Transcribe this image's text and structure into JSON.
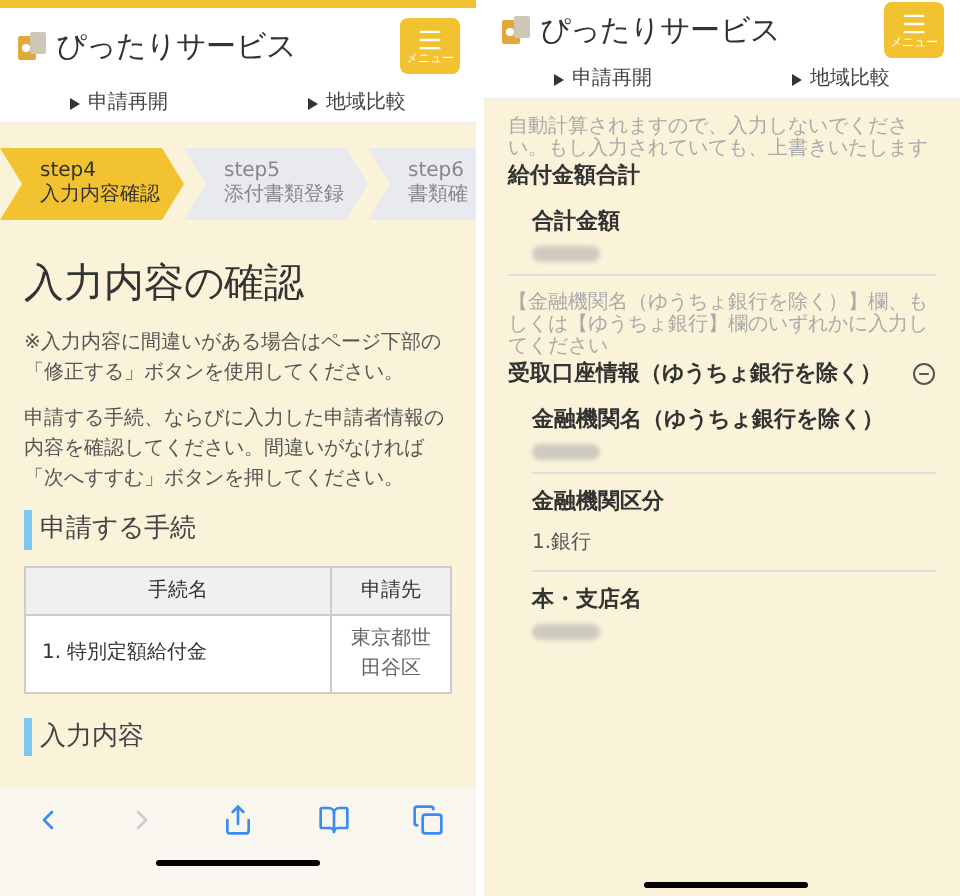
{
  "left": {
    "header": {
      "title": "ぴったりサービス",
      "menu_label": "メニュー"
    },
    "nav": [
      "申請再開",
      "地域比較"
    ],
    "steps": [
      {
        "step": "step4",
        "label": "入力内容確認",
        "selected": true
      },
      {
        "step": "step5",
        "label": "添付書類登録",
        "selected": false
      },
      {
        "step": "step6",
        "label": "書類確",
        "selected": false
      }
    ],
    "page_title": "入力内容の確認",
    "notes": [
      "※入力内容に間違いがある場合はページ下部の「修正する」ボタンを使用してください。",
      "申請する手続、ならびに入力した申請者情報の内容を確認してください。間違いがなければ「次へすすむ」ボタンを押してください。"
    ],
    "section_title": "申請する手続",
    "table": {
      "columns": [
        "手続名",
        "申請先"
      ],
      "rows": [
        [
          "1. 特別定額給付金",
          "東京都世田谷区"
        ]
      ]
    },
    "section_title_2": "入力内容",
    "toolbar": [
      {
        "disabled": false
      },
      {
        "disabled": true
      },
      {
        "disabled": false
      },
      {
        "disabled": false
      },
      {
        "disabled": false
      }
    ]
  },
  "right": {
    "header": {
      "title": "ぴったりサービス",
      "menu_label": "メニュー"
    },
    "nav": [
      "申請再開",
      "地域比較"
    ],
    "groups": [
      {
        "hint": "自動計算されますので、入力しないでください。もし入力されていても、上書きいたします",
        "title": "給付金額合計",
        "kind": "plain",
        "fields": [
          {
            "label": "合計金額",
            "kind": "redacted"
          }
        ]
      },
      {
        "hint": "【金融機関名（ゆうちょ銀行を除く）】欄、もしくは【ゆうちょ銀行】欄のいずれかに入力してください",
        "title": "受取口座情報（ゆうちょ銀行を除く）",
        "kind": "collapsible",
        "expanded": true,
        "fields": [
          {
            "label": "金融機関名（ゆうちょ銀行を除く）",
            "kind": "redacted"
          },
          {
            "label": "金融機関区分",
            "kind": "text",
            "value": "1.銀行"
          },
          {
            "label": "本・支店名",
            "kind": "redacted"
          }
        ]
      }
    ]
  }
}
